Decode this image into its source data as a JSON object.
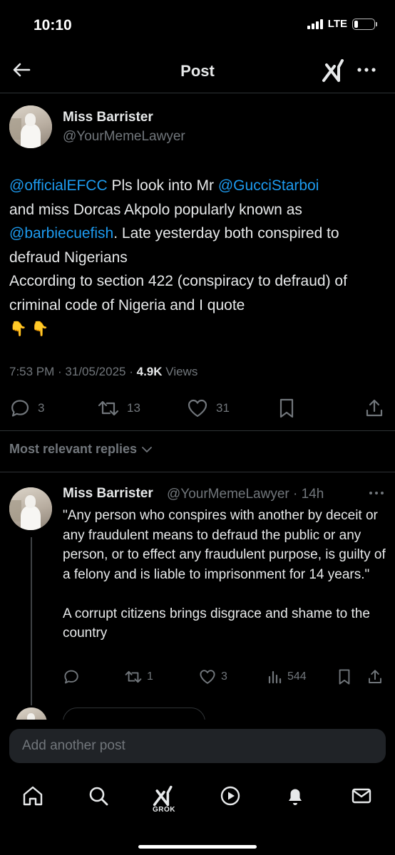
{
  "status_bar": {
    "time": "10:10",
    "network": "LTE",
    "battery_level": 0.2
  },
  "header": {
    "title": "Post"
  },
  "post": {
    "author_name": "Miss Barrister",
    "author_handle": "@YourMemeLawyer",
    "mention_efcc": "@officialEFCC",
    "text_1": " Pls look into Mr ",
    "mention_gucci": "@GucciStarboi",
    "text_2": "and miss Dorcas Akpolo popularly known as",
    "mention_barbie": "@barbiecuefish",
    "text_3": ". Late yesterday both conspired to defraud Nigerians",
    "text_4": "According to section 422 (conspiracy to defraud) of criminal code of Nigeria and I quote",
    "emoji": "👇 👇",
    "time": "7:53 PM",
    "date": "31/05/2025",
    "views_count": "4.9K",
    "views_label": "Views",
    "replies": "3",
    "reposts": "13",
    "likes": "31"
  },
  "replies_filter": {
    "label": "Most relevant replies"
  },
  "reply": {
    "author_name": "Miss Barrister",
    "author_handle": "@YourMemeLawyer",
    "age": "14h",
    "paragraph_1": "\"Any person who conspires with another by deceit or any fraudulent means to defraud the public or any person, or to effect any fraudulent purpose, is guilty of a felony and is liable to imprisonment for 14 years.\"",
    "paragraph_2": "A corrupt citizens brings disgrace and shame to the country",
    "reposts": "1",
    "likes": "3",
    "views": "544"
  },
  "compose": {
    "placeholder": "Add another post"
  },
  "bottom_nav": {
    "items": [
      "home-icon",
      "search-icon",
      "grok-icon",
      "video-icon",
      "notifications-icon",
      "messages-icon"
    ],
    "grok_label": "GROK"
  },
  "colors": {
    "accent": "#1d9bf0",
    "muted": "#71767b",
    "text": "#e7e9ea",
    "background": "#000000"
  }
}
